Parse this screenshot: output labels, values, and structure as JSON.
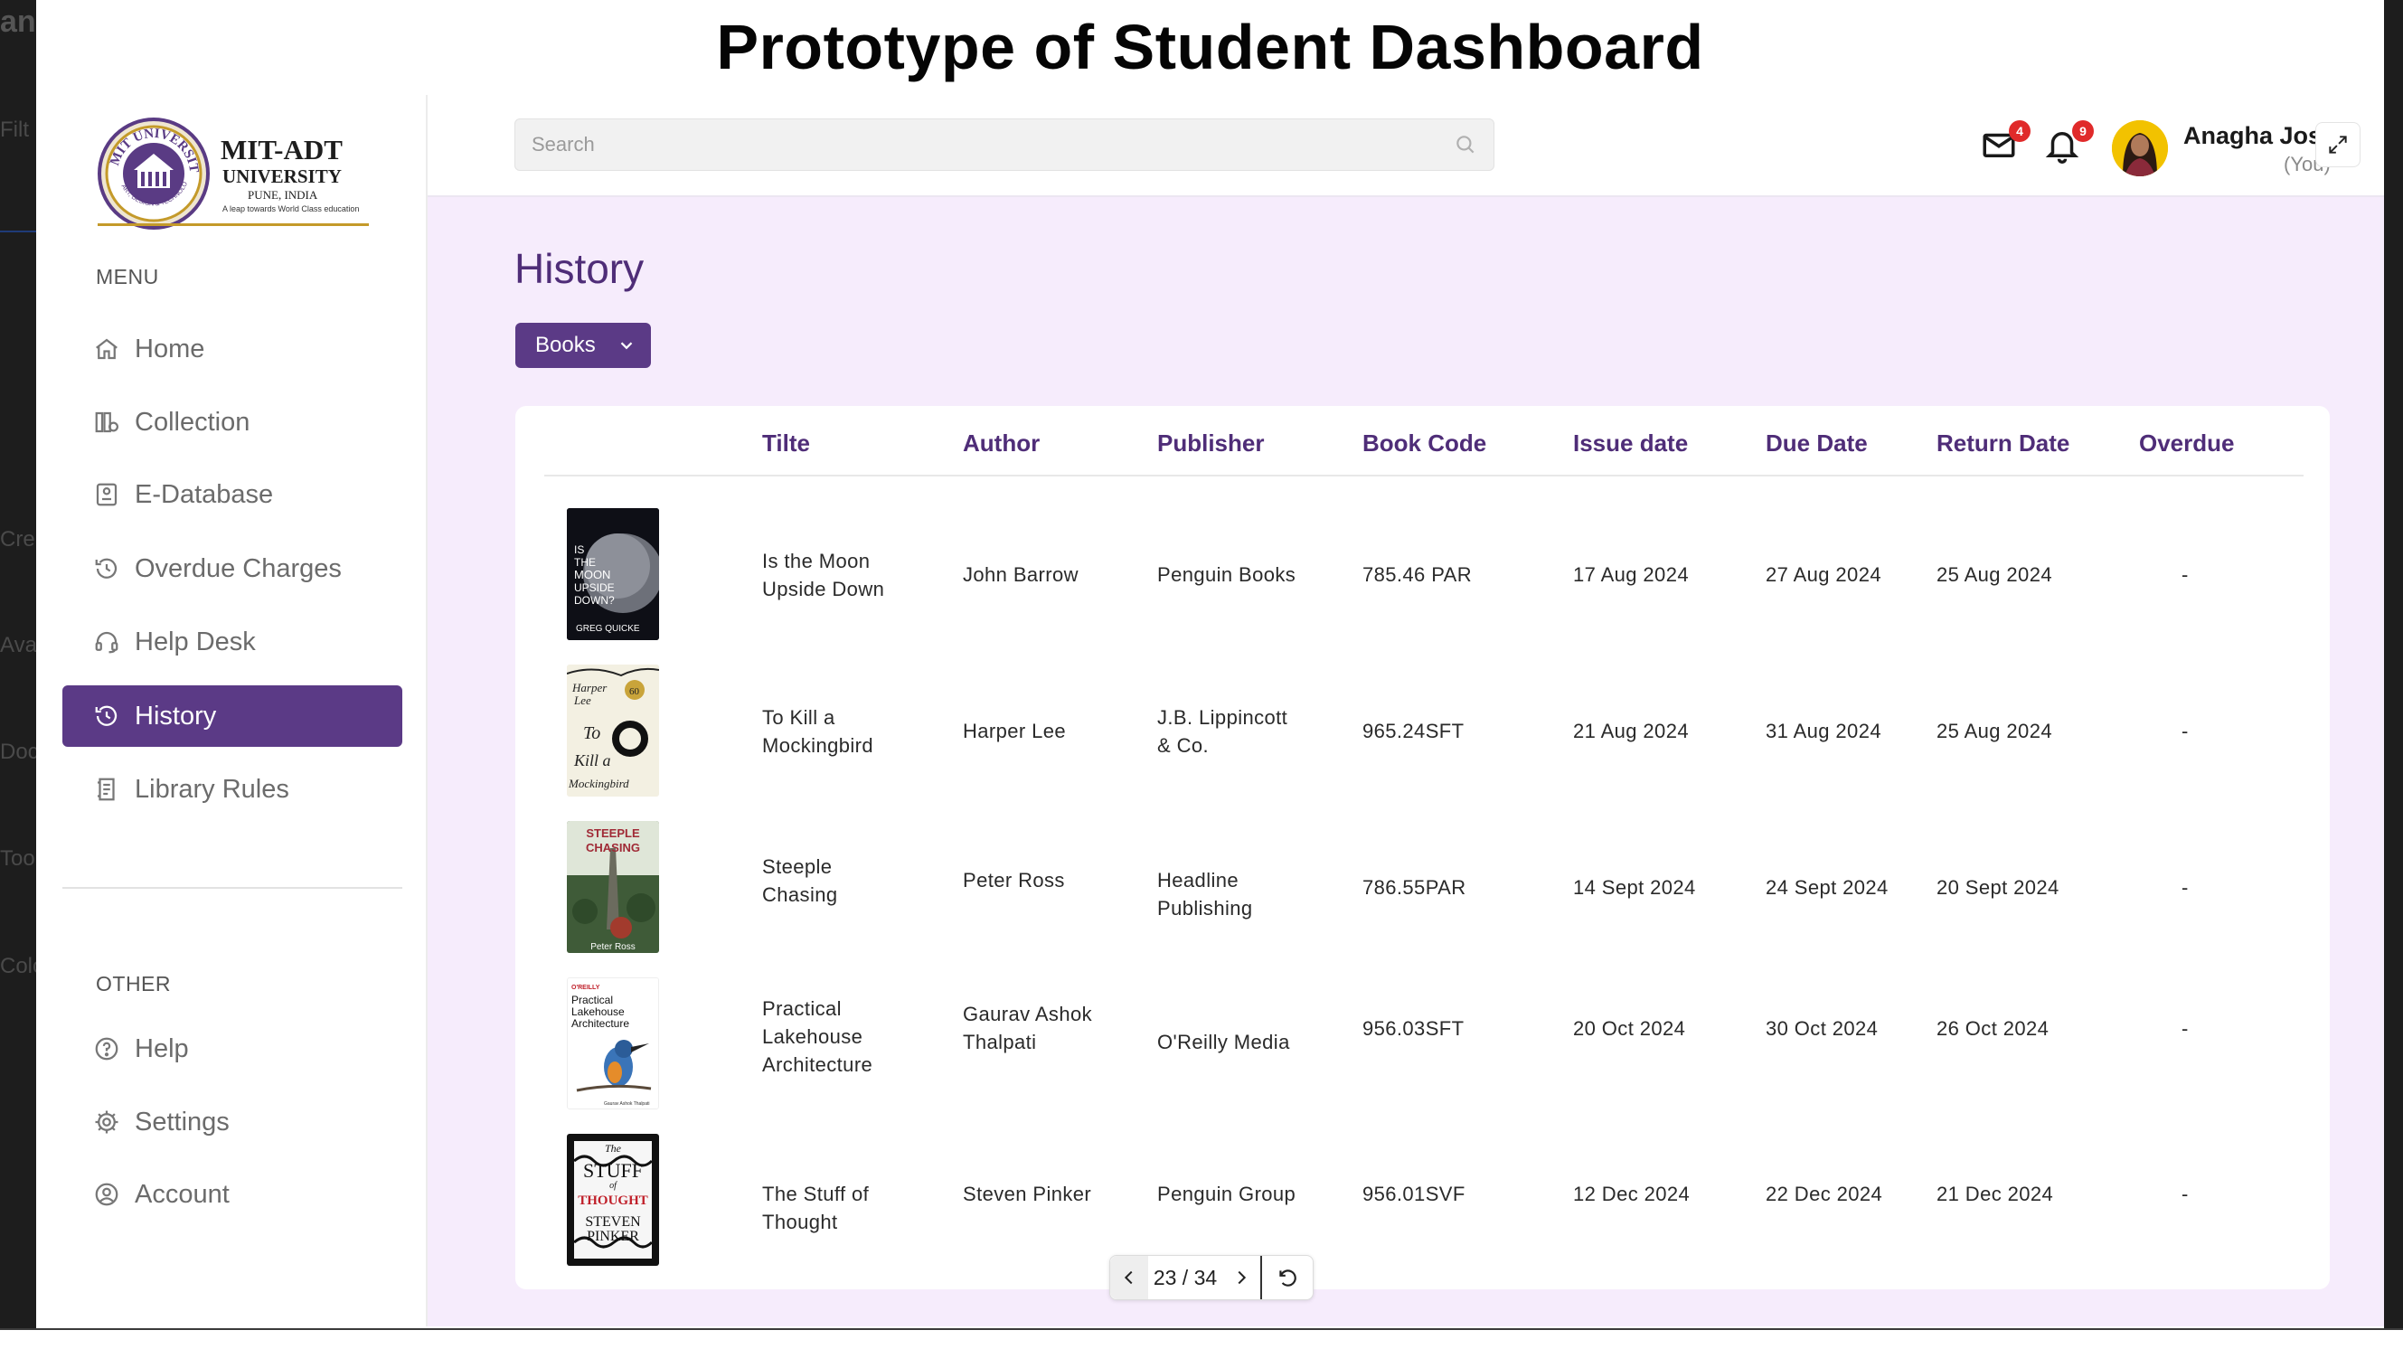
{
  "banner_title": "Prototype of Student Dashboard",
  "left_strip_fragments": [
    "an",
    "Filt",
    "Cre",
    "Avai",
    "Docs",
    "Tools",
    "Colo"
  ],
  "brand": {
    "name_line1": "MIT-ADT",
    "name_line2": "UNIVERSITY",
    "location": "PUNE, INDIA",
    "tagline": "A leap towards World Class education",
    "seal_text": "MIT UNIVERSITY",
    "seal_bottom": "ART, DESIGN & TECHNOLOGY"
  },
  "sidebar": {
    "menu_label": "MENU",
    "menu_items": [
      {
        "label": "Home",
        "icon": "home-icon"
      },
      {
        "label": "Collection",
        "icon": "collection-icon"
      },
      {
        "label": "E-Database",
        "icon": "database-icon"
      },
      {
        "label": "Overdue Charges",
        "icon": "clock-dollar-icon"
      },
      {
        "label": "Help Desk",
        "icon": "headset-icon"
      },
      {
        "label": "History",
        "icon": "history-icon",
        "active": true
      },
      {
        "label": "Library Rules",
        "icon": "rules-icon"
      }
    ],
    "other_label": "OTHER",
    "other_items": [
      {
        "label": "Help",
        "icon": "help-icon"
      },
      {
        "label": "Settings",
        "icon": "gear-icon"
      },
      {
        "label": "Account",
        "icon": "account-icon"
      }
    ]
  },
  "header": {
    "search_placeholder": "Search",
    "mail_count": "4",
    "notification_count": "9",
    "user_name": "Anagha Joshi",
    "user_sub": "(You)"
  },
  "page": {
    "title": "History",
    "filter_label": "Books"
  },
  "table": {
    "columns": [
      "Tilte",
      "Author",
      "Publisher",
      "Book Code",
      "Issue date",
      "Due Date",
      "Return Date",
      "Overdue"
    ],
    "rows": [
      {
        "title": [
          "Is the Moon",
          "Upside Down"
        ],
        "author": [
          "John Barrow"
        ],
        "publisher": [
          "Penguin Books"
        ],
        "code": "785.46 PAR",
        "issue": "17 Aug 2024",
        "due": "27 Aug 2024",
        "return": "25 Aug 2024",
        "overdue": "-",
        "cover_text": [
          "IS",
          "THE",
          "MOON",
          "UPSIDE",
          "DOWN?",
          "GREG QUICKE"
        ]
      },
      {
        "title": [
          "To Kill a",
          "Mockingbird"
        ],
        "author": [
          "Harper Lee"
        ],
        "publisher": [
          "J.B. Lippincott",
          "& Co."
        ],
        "code": "965.24SFT",
        "issue": "21 Aug 2024",
        "due": "31 Aug 2024",
        "return": "25 Aug 2024",
        "overdue": "-",
        "cover_text": [
          "Harper",
          "Lee",
          "To",
          "Kill a",
          "Mockingbird",
          "60"
        ]
      },
      {
        "title": [
          "Steeple",
          "Chasing"
        ],
        "author": [
          "Peter Ross"
        ],
        "publisher": [
          "Headline",
          "Publishing"
        ],
        "code": "786.55PAR",
        "issue": "14 Sept 2024",
        "due": "24 Sept 2024",
        "return": "20 Sept 2024",
        "overdue": "-",
        "cover_text": [
          "STEEPLE",
          "CHASING",
          "Peter Ross"
        ]
      },
      {
        "title": [
          "Practical",
          "Lakehouse",
          "Architecture"
        ],
        "author": [
          "Gaurav Ashok",
          "Thalpati"
        ],
        "publisher": [
          "O'Reilly Media"
        ],
        "code": "956.03SFT",
        "issue": "20 Oct 2024",
        "due": "30 Oct 2024",
        "return": "26 Oct 2024",
        "overdue": "-",
        "cover_text": [
          "O'REILLY",
          "Practical",
          "Lakehouse",
          "Architecture",
          "Gaurav Ashok Thalpati"
        ]
      },
      {
        "title": [
          "The Stuff of",
          "Thought"
        ],
        "author": [
          "Steven Pinker"
        ],
        "publisher": [
          "Penguin Group"
        ],
        "code": "956.01SVF",
        "issue": "12 Dec 2024",
        "due": "22 Dec 2024",
        "return": "21 Dec 2024",
        "overdue": "-",
        "cover_text": [
          "The",
          "STUFF",
          "of",
          "THOUGHT",
          "STEVEN",
          "PINKER"
        ]
      }
    ]
  },
  "pagination": {
    "label": "23 / 34"
  },
  "colors": {
    "accent": "#5b3a86",
    "heading": "#4f2d78",
    "main_bg": "#f6ecfc",
    "badge": "#e02a2a"
  }
}
